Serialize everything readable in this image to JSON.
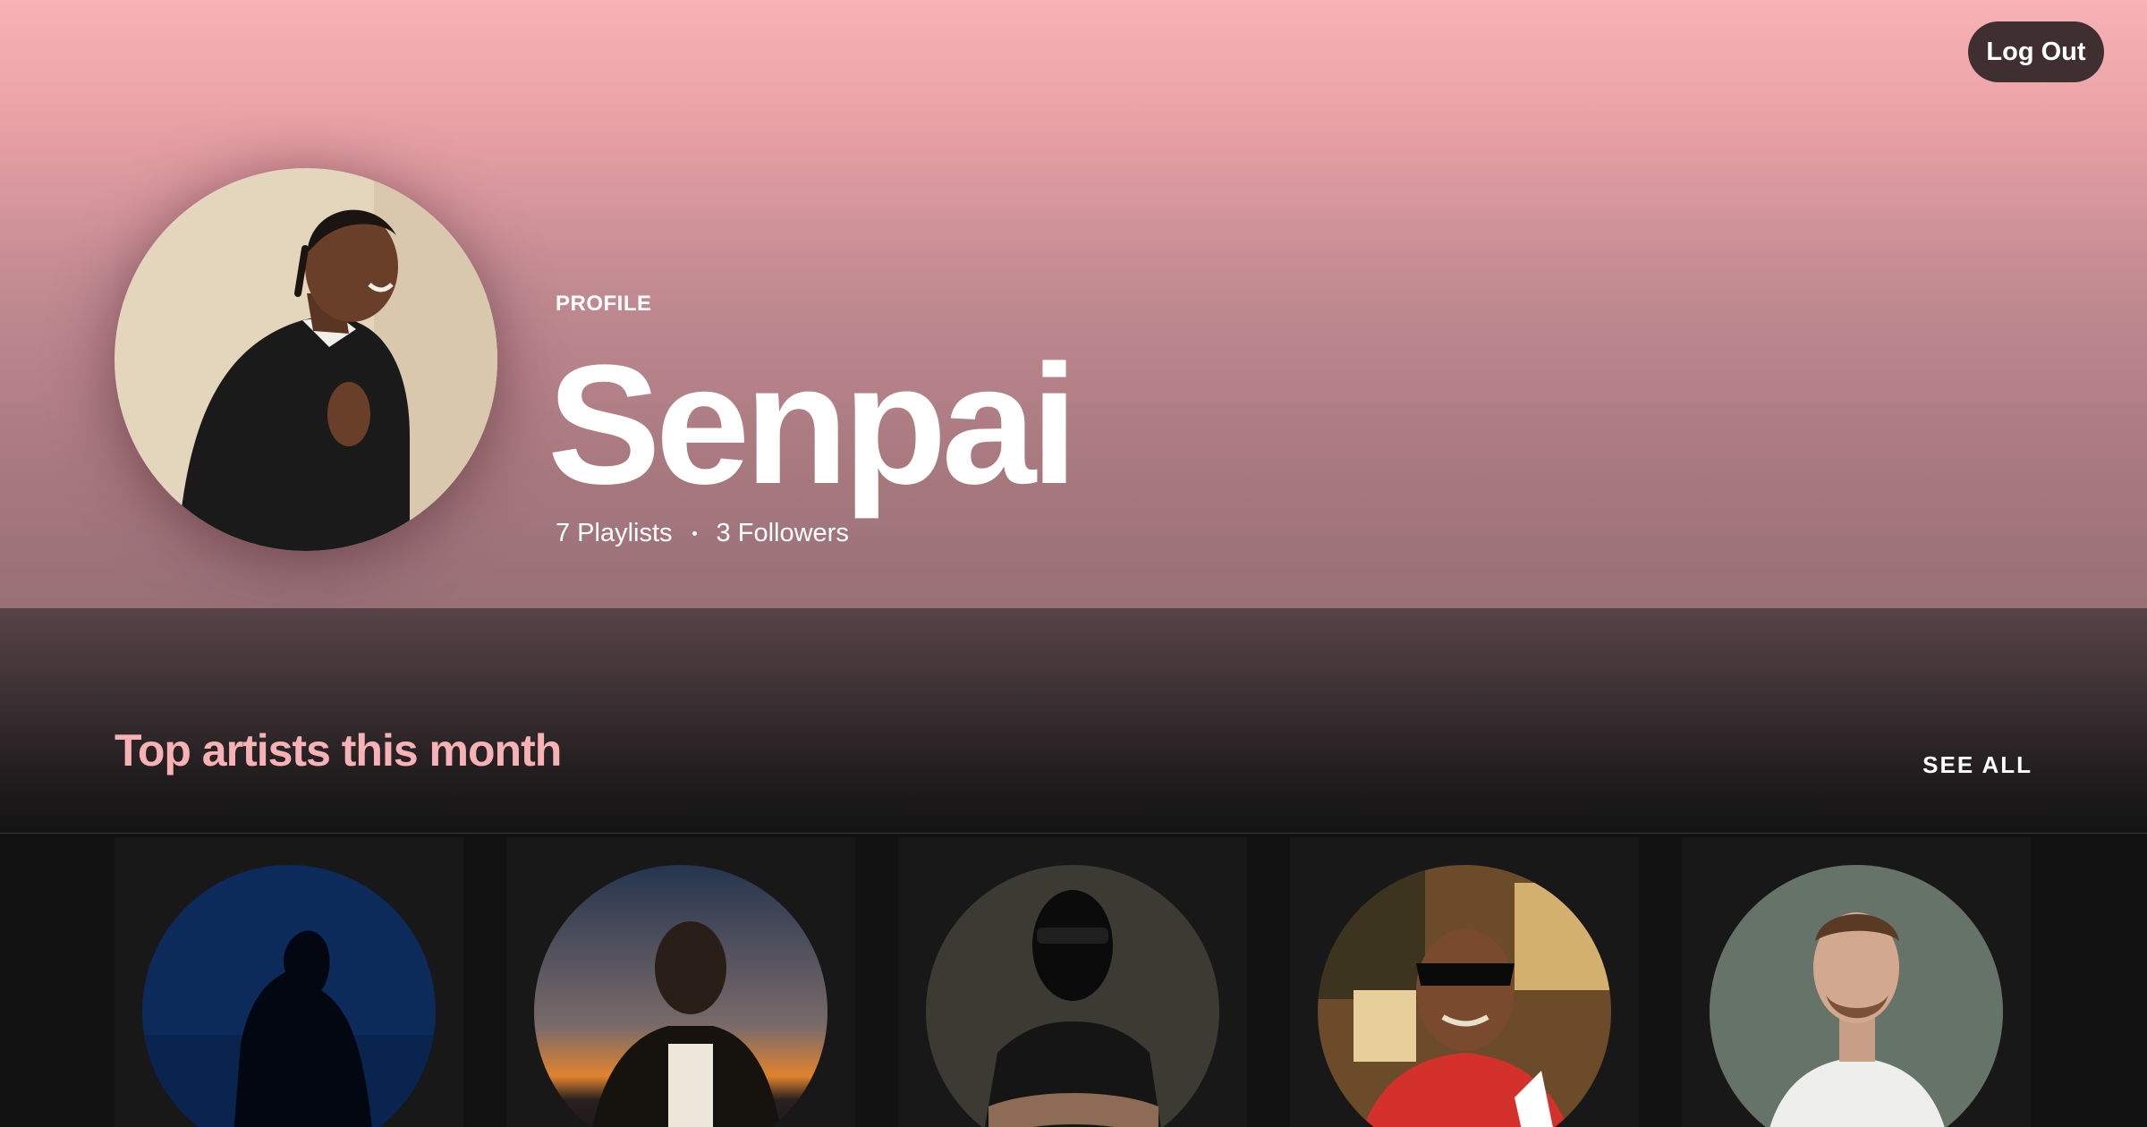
{
  "header": {
    "logout_label": "Log Out"
  },
  "profile": {
    "label": "PROFILE",
    "name": "Senpai",
    "playlists": "7 Playlists",
    "followers": "3 Followers"
  },
  "top_artists": {
    "title": "Top artists this month",
    "see_all_label": "SEE ALL",
    "items": [
      {
        "image": "artist-photo-1"
      },
      {
        "image": "artist-photo-2"
      },
      {
        "image": "artist-photo-3"
      },
      {
        "image": "artist-photo-4"
      },
      {
        "image": "artist-photo-5"
      }
    ]
  },
  "colors": {
    "hero_top": "#f8b3b6",
    "hero_bottom": "#987076",
    "section_title": "#f7b2b5",
    "background": "#121212",
    "card": "#181818",
    "logout_button": "#3f2f31"
  }
}
